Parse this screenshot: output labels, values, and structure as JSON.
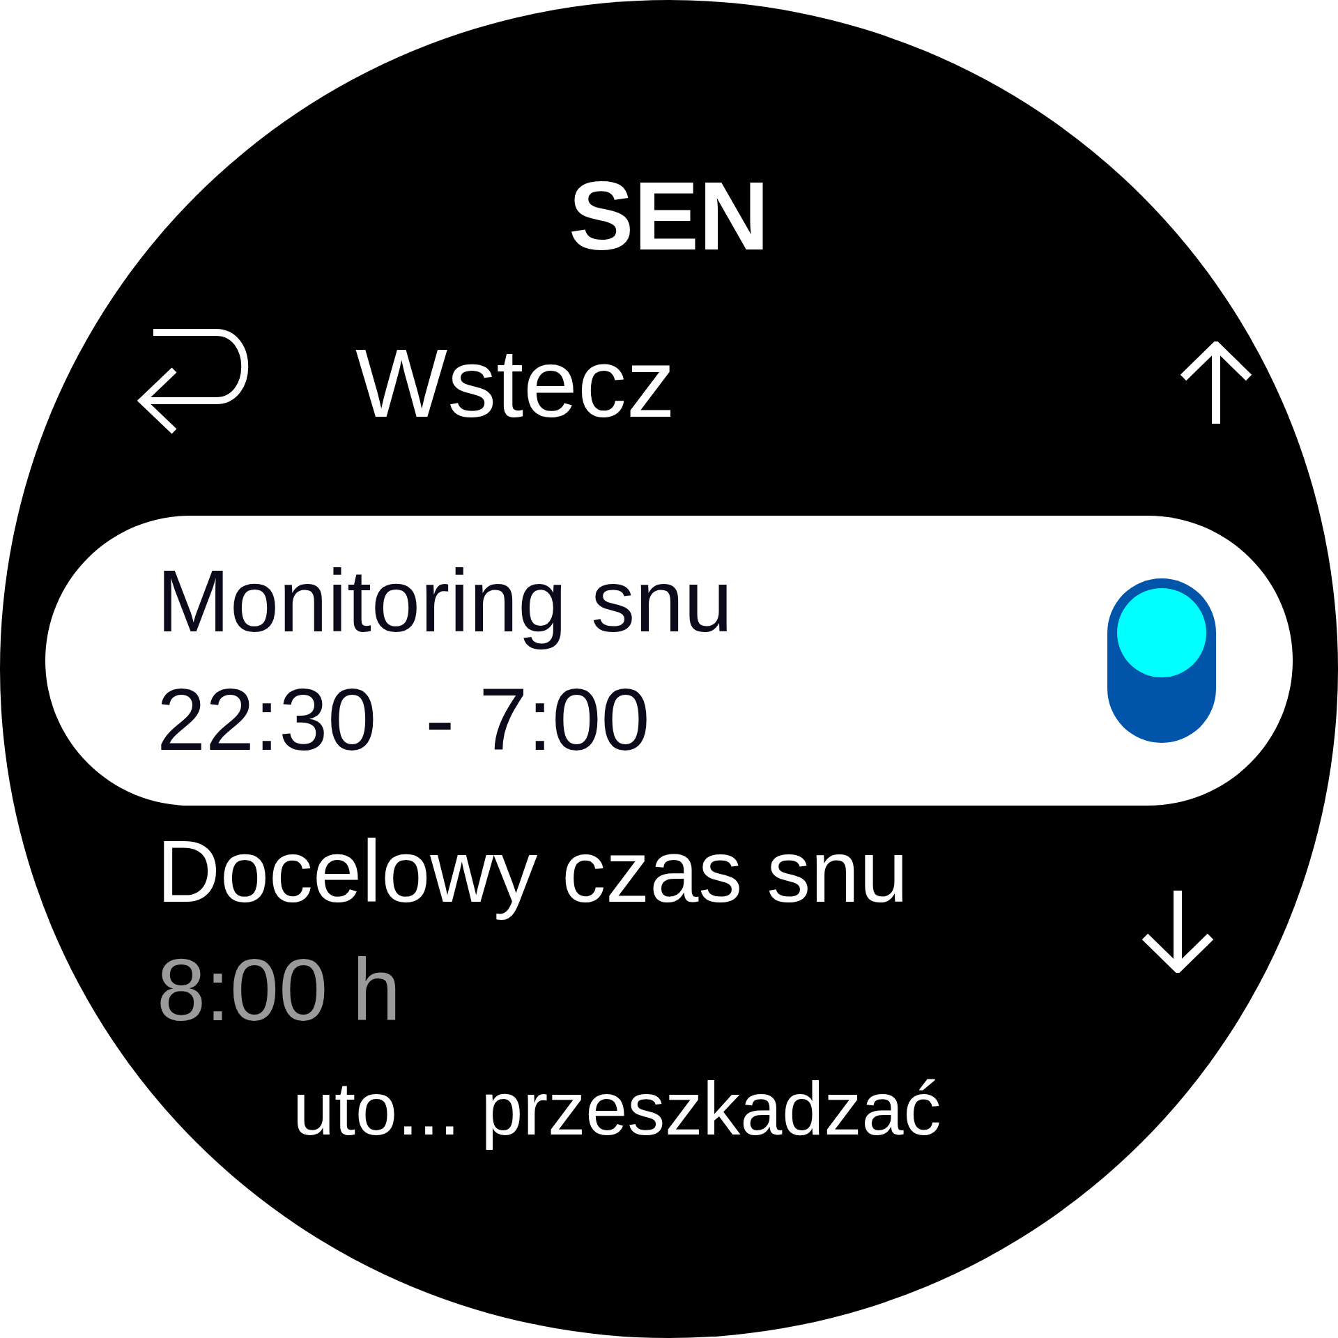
{
  "title": "SEN",
  "back": {
    "label": "Wstecz"
  },
  "items": [
    {
      "kind": "toggle",
      "label": "Monitoring snu",
      "value": "22:30  - 7:00",
      "selected": true,
      "on": true
    },
    {
      "kind": "value",
      "label": "Docelowy czas snu",
      "value": "8:00 h",
      "selected": false
    },
    {
      "kind": "value",
      "label": "uto... przeszkadzać",
      "selected": false
    }
  ]
}
